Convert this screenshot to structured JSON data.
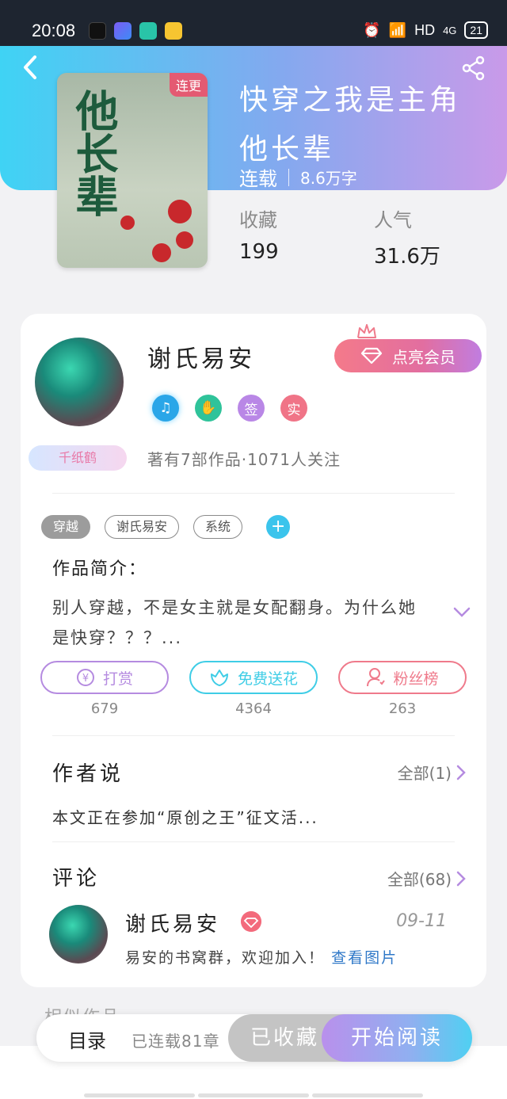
{
  "status_bar": {
    "time": "20:08",
    "network": "HD",
    "signal": "4G",
    "battery": "21"
  },
  "book": {
    "cover_tag": "连更",
    "cover_art_text": "他长辈",
    "title": "快穿之我是主角他长辈",
    "status": "连载",
    "words": "8.6万字",
    "stats": [
      {
        "label": "收藏",
        "value": "199"
      },
      {
        "label": "人气",
        "value": "31.6万"
      }
    ]
  },
  "author": {
    "name": "谢氏易安",
    "badge": "千纸鹤",
    "vip_button": "点亮会员",
    "mini_badges": [
      {
        "icon": "music-note-icon",
        "text": "♫",
        "color": "#2aa6e8"
      },
      {
        "icon": "handshake-icon",
        "text": "✋",
        "color": "#2fc39a"
      },
      {
        "icon": "sign-icon",
        "text": "签",
        "color": "#b987e6"
      },
      {
        "icon": "verified-icon",
        "text": "实",
        "color": "#f07487"
      }
    ],
    "stats": "著有7部作品·1071人关注"
  },
  "tags": [
    "穿越",
    "谢氏易安",
    "系统"
  ],
  "intro": {
    "title": "作品简介：",
    "text": "别人穿越，不是女主就是女配翻身。为什么她是快穿？？？..."
  },
  "actions": [
    {
      "label": "打赏",
      "icon": "yen-icon",
      "count": "679",
      "color": "#b58be0"
    },
    {
      "label": "免费送花",
      "icon": "flower-icon",
      "count": "4364",
      "color": "#3fcde6"
    },
    {
      "label": "粉丝榜",
      "icon": "fan-icon",
      "count": "263",
      "color": "#ef7a8b"
    }
  ],
  "author_says": {
    "title": "作者说",
    "more": "全部(1)",
    "text": "本文正在参加“原创之王”征文活..."
  },
  "comments": {
    "title": "评论",
    "more": "全部(68)",
    "item": {
      "name": "谢氏易安",
      "date": "09-11",
      "text": "易安的书窝群，欢迎加入！",
      "link": "查看图片"
    }
  },
  "related_title": "相似作品",
  "bottom": {
    "toc": "目录",
    "toc_status": "已连载81章",
    "collected": "已收藏",
    "read": "开始阅读"
  }
}
